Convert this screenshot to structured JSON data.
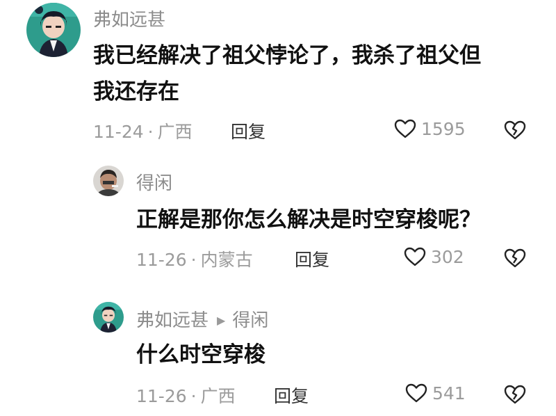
{
  "comments": [
    {
      "username": "弗如远甚",
      "content_line1": "我已经解决了祖父悖论了，我杀了祖父但",
      "content_line2": "我还存在",
      "date": "11-24",
      "location": "广西",
      "reply_label": "回复",
      "likes": "1595"
    },
    {
      "username": "得闲",
      "content_line1": "正解是那你怎么解决是时空穿梭呢？",
      "date": "11-26",
      "location": "内蒙古",
      "reply_label": "回复",
      "likes": "302"
    },
    {
      "username": "弗如远甚",
      "reply_to": "得闲",
      "content_line1": "什么时空穿梭",
      "date": "11-26",
      "location": "广西",
      "reply_label": "回复",
      "likes": "541"
    }
  ],
  "separator": "·",
  "icons": {
    "like": "heart-outline-icon",
    "dislike": "broken-heart-icon",
    "reply_arrow": "play-triangle-icon"
  },
  "colors": {
    "text_primary": "#111111",
    "text_secondary": "#9b9b9b",
    "avatar_bg": "#2e9c8c"
  }
}
